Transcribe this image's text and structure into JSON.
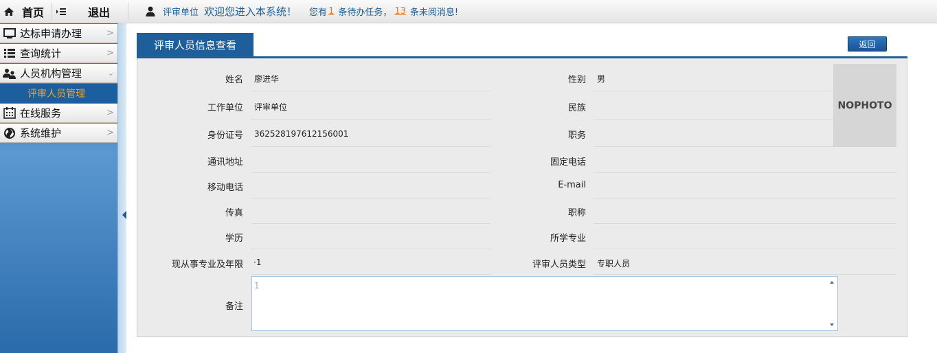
{
  "topbar": {
    "home_label": "首页",
    "logout_label": "退出",
    "user_unit": "评审单位",
    "welcome": "欢迎您进入本系统！",
    "todo_prefix": "您有",
    "todo_count": "1",
    "todo_suffix": "条待办任务，",
    "msg_count": "13",
    "msg_suffix": "条未阅消息!"
  },
  "sidebar": {
    "items": [
      {
        "label": "达标申请办理",
        "icon": "monitor-icon"
      },
      {
        "label": "查询统计",
        "icon": "list-icon"
      },
      {
        "label": "人员机构管理",
        "icon": "users-icon"
      },
      {
        "label": "在线服务",
        "icon": "calendar-icon"
      },
      {
        "label": "系统维护",
        "icon": "globe-icon"
      }
    ],
    "sub_item": "评审人员管理"
  },
  "main": {
    "tab_title": "评审人员信息查看",
    "back_label": "返回",
    "photo_text": "NOPHOTO",
    "fields": {
      "name_label": "姓名",
      "name_value": "廖进华",
      "gender_label": "性别",
      "gender_value": "男",
      "unit_label": "工作单位",
      "unit_value": "评审单位",
      "ethnic_label": "民族",
      "ethnic_value": "",
      "id_label": "身份证号",
      "id_value": "362528197612156001",
      "duty_label": "职务",
      "duty_value": "",
      "address_label": "通讯地址",
      "address_value": "",
      "phone_label": "固定电话",
      "phone_value": "",
      "mobile_label": "移动电话",
      "mobile_value": "",
      "email_label": "E-mail",
      "email_value": "",
      "fax_label": "传真",
      "fax_value": "",
      "title_label": "职称",
      "title_value": "",
      "edu_label": "学历",
      "edu_value": "",
      "major_label": "所学专业",
      "major_value": "",
      "years_label": "现从事专业及年限",
      "years_value": "·1",
      "type_label": "评审人员类型",
      "type_value": "专职人员",
      "remark_label": "备注",
      "remark_value": "1"
    }
  }
}
